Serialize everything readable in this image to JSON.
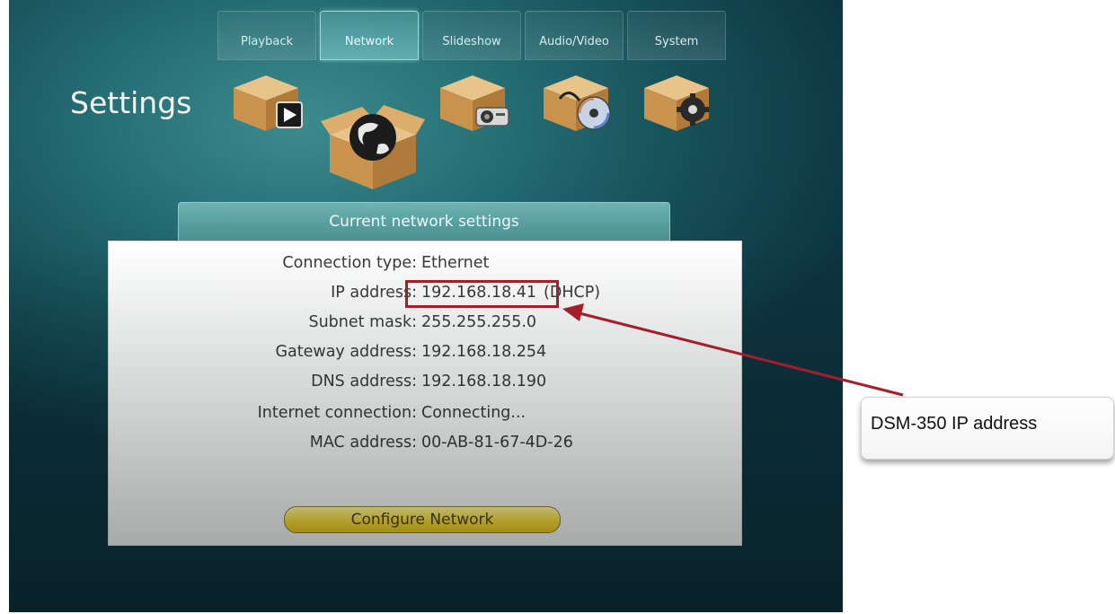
{
  "screen": {
    "title": "Settings",
    "tabs": [
      {
        "label": "Playback",
        "icon": "playback-box-icon",
        "active": false
      },
      {
        "label": "Network",
        "icon": "network-box-icon",
        "active": true
      },
      {
        "label": "Slideshow",
        "icon": "slideshow-box-icon",
        "active": false
      },
      {
        "label": "Audio/Video",
        "icon": "audio-video-box-icon",
        "active": false
      },
      {
        "label": "System",
        "icon": "system-box-icon",
        "active": false
      }
    ],
    "panel_title": "Current network settings",
    "fields": [
      {
        "label": "Connection type:",
        "value": "Ethernet"
      },
      {
        "label": "IP address:",
        "value": "192.168.18.41",
        "suffix": "(DHCP)"
      },
      {
        "label": "Subnet mask:",
        "value": "255.255.255.0"
      },
      {
        "label": "Gateway address:",
        "value": "192.168.18.254"
      },
      {
        "label": "DNS address:",
        "value": "192.168.18.190"
      },
      {
        "label": "Internet connection:",
        "value": "Connecting..."
      },
      {
        "label": "MAC address:",
        "value": "00-AB-81-67-4D-26"
      }
    ],
    "configure_button": "Configure Network"
  },
  "annotation": {
    "callout_text": "DSM-350 IP address",
    "highlight_color": "#a71e2b"
  },
  "colors": {
    "background_teal": "#256e74",
    "button_yellow": "#f1d838",
    "annotation_red": "#a71e2b"
  }
}
